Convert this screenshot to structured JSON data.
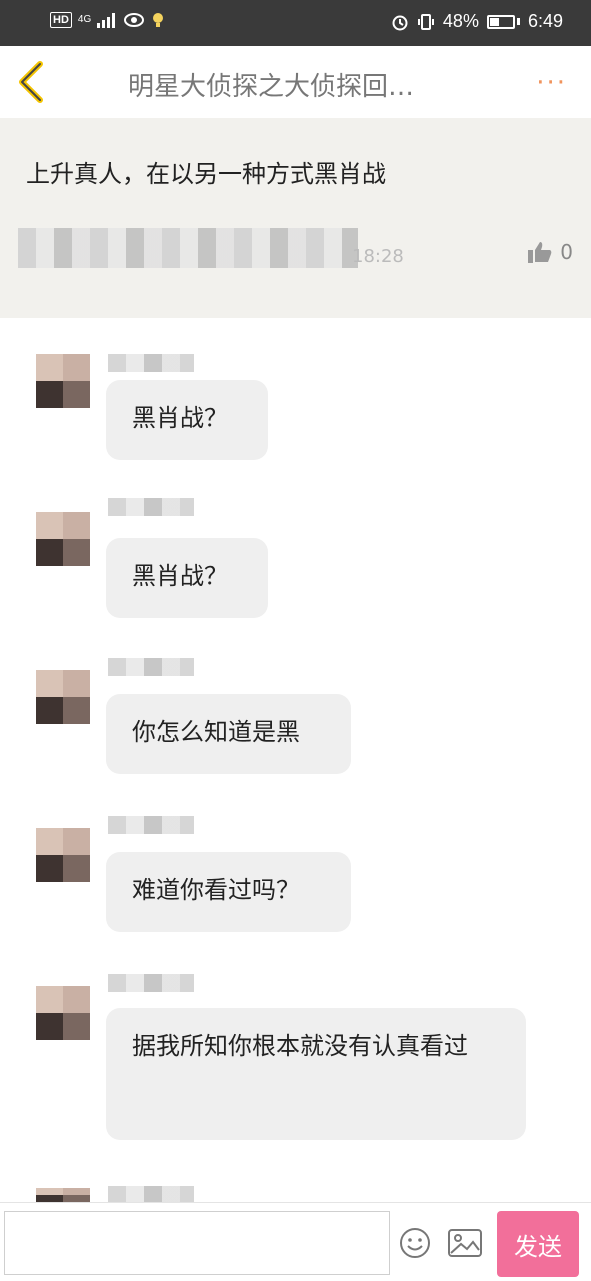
{
  "status_bar": {
    "network_badge": "HD",
    "network_type": "4G",
    "battery_percent": "48%",
    "battery_level": 0.48,
    "time": "6:49",
    "icons": [
      "signal-icon",
      "eye-icon",
      "bulb-icon",
      "alarm-icon",
      "vibrate-icon",
      "battery-icon"
    ]
  },
  "header": {
    "title": "明星大侦探之大侦探回…",
    "back_icon": "back-chevron-icon",
    "more_icon": "more-dots-icon"
  },
  "post": {
    "text": "上升真人，在以另一种方式黑肖战",
    "time_visible": "18:28",
    "like_count": "0"
  },
  "messages": [
    {
      "text": "黑肖战？"
    },
    {
      "text": "黑肖战？"
    },
    {
      "text": "你怎么知道是黑"
    },
    {
      "text": "难道你看过吗？"
    },
    {
      "text": "据我所知你根本就没有认真看过"
    }
  ],
  "input_bar": {
    "placeholder": "",
    "emoji_icon": "emoji-icon",
    "image_icon": "image-icon",
    "send_label": "发送"
  },
  "colors": {
    "accent_orange": "#f0935c",
    "send_pink": "#f26f9a",
    "post_bg": "#f2f1ed",
    "bubble_bg": "#efefef"
  }
}
